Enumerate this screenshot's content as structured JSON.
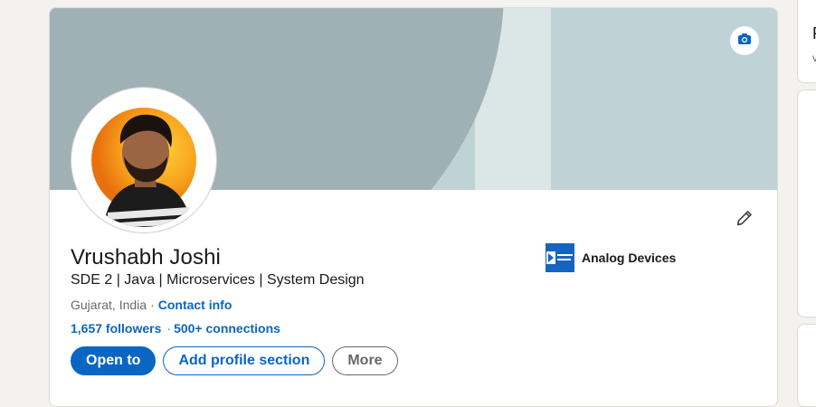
{
  "profile": {
    "name": "Vrushabh Joshi",
    "headline": "SDE 2 | Java | Microservices | System Design",
    "location": "Gujarat, India",
    "location_separator": "·",
    "contact_info_label": "Contact info",
    "followers": "1,657 followers",
    "stats_separator": "·",
    "connections": "500+ connections"
  },
  "current_company": {
    "name": "Analog Devices",
    "logo_text": "ANALOG DEVICES"
  },
  "actions": {
    "open_to_label": "Open to",
    "add_section_label": "Add profile section",
    "more_label": "More"
  },
  "right_rail": {
    "peek_title_fragment": "P",
    "peek_sub_fragment": "v"
  },
  "icons": {
    "camera": "camera-icon",
    "edit": "pencil-icon"
  },
  "colors": {
    "brand_blue": "#0a66c2",
    "page_bg": "#f3f2ef",
    "banner_light": "#bfd2d6",
    "banner_dark": "#a0b1b5",
    "avatar_ring": "#f5a524"
  }
}
